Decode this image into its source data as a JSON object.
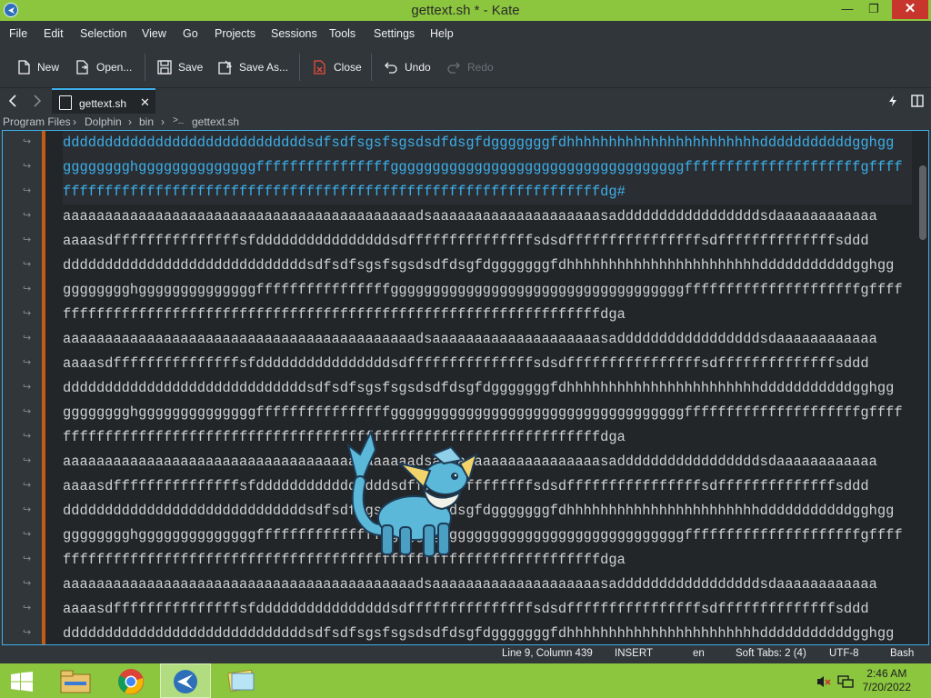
{
  "window": {
    "title": "gettext.sh * - Kate",
    "minimize": "—",
    "maximize": "❐",
    "close": "✕"
  },
  "menu": [
    "File",
    "Edit",
    "Selection",
    "View",
    "Go",
    "Projects",
    "Sessions",
    "Tools",
    "Settings",
    "Help"
  ],
  "toolbar": {
    "new": "New",
    "open": "Open...",
    "save": "Save",
    "save_as": "Save As...",
    "close": "Close",
    "undo": "Undo",
    "redo": "Redo"
  },
  "tabs": {
    "active": "gettext.sh"
  },
  "breadcrumb": [
    "Program Files",
    "Dolphin",
    "bin",
    "gettext.sh"
  ],
  "editor": {
    "lines": [
      {
        "text": "dddddddddddddddddddddddddddddsdfsdfsgsfsgsdsdfdsgfdgggggggfdhhhhhhhhhhhhhhhhhhhhhhhdddddddddddgghgg",
        "sel": true
      },
      {
        "text": "gggggggghggggggggggggggffffffffffffffffgggggggggggggggggggggggggggggggggggfffffffffffffffffffffgffff",
        "sel": true
      },
      {
        "text": "ffffffffffffffffffffffffffffffffffffffffffffffffffffffffffffffffdg#",
        "sel": true
      },
      {
        "text": "aaaaaaaaaaaaaaaaaaaaaaaaaaaaaaaaaaaaaaaaaadsaaaaaaaaaaaaaaaaaaaasadddddddddddddddddsdaaaaaaaaaaaa",
        "sel": false
      },
      {
        "text": "aaaasdfffffffffffffffsfddddddddddddddddsdfffffffffffffffsdsdffffffffffffffffsdffffffffffffffsddd",
        "sel": false
      },
      {
        "text": "dddddddddddddddddddddddddddddsdfsdfsgsfsgsdsdfdsgfdgggggggfdhhhhhhhhhhhhhhhhhhhhhhhdddddddddddgghgg",
        "sel": false
      },
      {
        "text": "gggggggghggggggggggggggffffffffffffffffgggggggggggggggggggggggggggggggggggfffffffffffffffffffffgffff",
        "sel": false
      },
      {
        "text": "ffffffffffffffffffffffffffffffffffffffffffffffffffffffffffffffffdga",
        "sel": false
      },
      {
        "text": "aaaaaaaaaaaaaaaaaaaaaaaaaaaaaaaaaaaaaaaaaadsaaaaaaaaaaaaaaaaaaaasadddddddddddddddddsdaaaaaaaaaaaa",
        "sel": false
      },
      {
        "text": "aaaasdfffffffffffffffsfddddddddddddddddsdfffffffffffffffsdsdffffffffffffffffsdffffffffffffffsddd",
        "sel": false
      },
      {
        "text": "dddddddddddddddddddddddddddddsdfsdfsgsfsgsdsdfdsgfdgggggggfdhhhhhhhhhhhhhhhhhhhhhhhdddddddddddgghgg",
        "sel": false
      },
      {
        "text": "gggggggghggggggggggggggffffffffffffffffgggggggggggggggggggggggggggggggggggfffffffffffffffffffffgffff",
        "sel": false
      },
      {
        "text": "ffffffffffffffffffffffffffffffffffffffffffffffffffffffffffffffffdga",
        "sel": false
      },
      {
        "text": "aaaaaaaaaaaaaaaaaaaaaaaaaaaaaaaaaaaaaaaaaadsaaaaaaaaaaaaaaaaaaaasadddddddddddddddddsdaaaaaaaaaaaa",
        "sel": false
      },
      {
        "text": "aaaasdfffffffffffffffsfddddddddddddddddsdfffffffffffffffsdsdffffffffffffffffsdffffffffffffffsddd",
        "sel": false
      },
      {
        "text": "dddddddddddddddddddddddddddddsdfsdfsgsfsgsdsdfdsgfdgggggggfdhhhhhhhhhhhhhhhhhhhhhhhdddddddddddgghgg",
        "sel": false
      },
      {
        "text": "gggggggghggggggggggggggffffffffffffffffgggggggggggggggggggggggggggggggggggfffffffffffffffffffffgffff",
        "sel": false
      },
      {
        "text": "ffffffffffffffffffffffffffffffffffffffffffffffffffffffffffffffffdga",
        "sel": false
      },
      {
        "text": "aaaaaaaaaaaaaaaaaaaaaaaaaaaaaaaaaaaaaaaaaadsaaaaaaaaaaaaaaaaaaaasadddddddddddddddddsdaaaaaaaaaaaa",
        "sel": false
      },
      {
        "text": "aaaasdfffffffffffffffsfddddddddddddddddsdfffffffffffffffsdsdffffffffffffffffsdffffffffffffffsddd",
        "sel": false
      },
      {
        "text": "dddddddddddddddddddddddddddddsdfsdfsgsfsgsdsdfdsgfdgggggggfdhhhhhhhhhhhhhhhhhhhhhhhdddddddddddgghgg",
        "sel": false
      }
    ]
  },
  "status": {
    "position": "Line 9, Column 439",
    "mode": "INSERT",
    "lang": "en",
    "tabs": "Soft Tabs: 2 (4)",
    "encoding": "UTF-8",
    "syntax": "Bash"
  },
  "taskbar": {
    "time": "2:46 AM",
    "date": "7/20/2022"
  },
  "colors": {
    "accent": "#3daee9",
    "titlebar": "#8cc63e",
    "close": "#c7352d"
  }
}
